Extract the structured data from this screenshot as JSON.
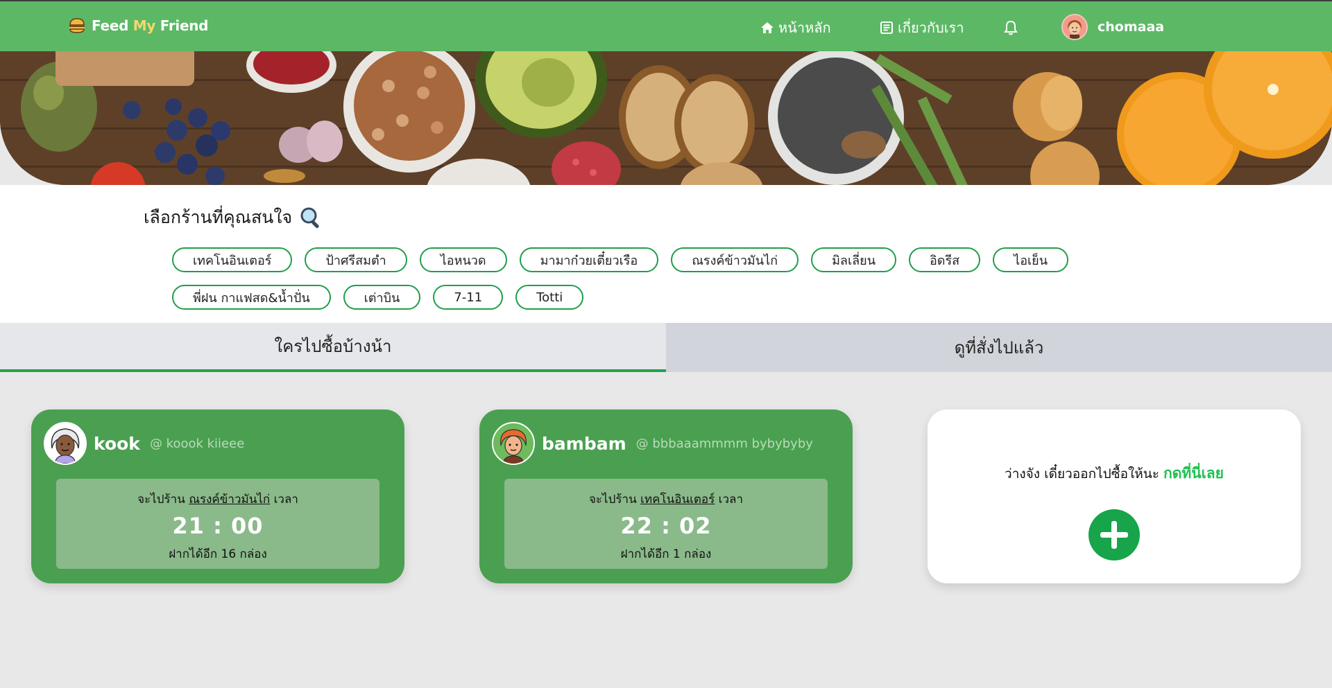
{
  "brand": {
    "name_part1": "Feed ",
    "name_part2": "My",
    "name_part3": " Friend"
  },
  "nav": {
    "home_label": "หน้าหลัก",
    "about_label": "เกี่ยวกับเรา",
    "username": "chomaaa"
  },
  "store_select": {
    "title": "เลือกร้านที่คุณสนใจ",
    "tags_row1": [
      "เทคโนอินเตอร์",
      "ป้าศรีสมตำ",
      "ไอหนวด",
      "มามาก๋วยเตี๋ยวเรือ",
      "ณรงค์ข้าวมันไก่",
      "มิลเลี่ยน",
      "อิดรีส",
      "ไอเย็น"
    ],
    "tags_row2": [
      "พี่ฝน กาแฟสด&น้ำปั่น",
      "เต่าบิน",
      "7-11",
      "Totti"
    ]
  },
  "tabs": {
    "active": "ใครไปซื้อบ้างน้า",
    "inactive": "ดูที่สั่งไปแล้ว"
  },
  "cards": [
    {
      "name": "kook",
      "handle": "@ koook kiieee",
      "going_prefix": "จะไปร้าน ",
      "store": "ณรงค์ข้าวมันไก่",
      "time_suffix": " เวลา",
      "time": "21 : 00",
      "capacity": "ฝากได้อีก 16 กล่อง"
    },
    {
      "name": "bambam",
      "handle": "@ bbbaaammmm bybybyby",
      "going_prefix": "จะไปร้าน ",
      "store": "เทคโนอินเตอร์",
      "time_suffix": " เวลา",
      "time": "22 : 02",
      "capacity": "ฝากได้อีก 1 กล่อง"
    }
  ],
  "cta": {
    "text": "ว่างจัง เดี๋ยวออกไปซื้อให้นะ ",
    "link": "กดที่นี่เลย"
  },
  "colors": {
    "primary": "#5cb865",
    "card_green": "#4aa050",
    "accent_green": "#1fa34a",
    "cta_green": "#22c051"
  },
  "icons": [
    "burger-icon",
    "home-icon",
    "info-icon",
    "bell-icon",
    "search-icon",
    "plus-icon"
  ]
}
